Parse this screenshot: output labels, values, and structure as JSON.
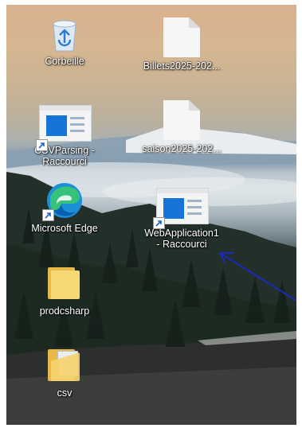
{
  "desktop": {
    "icons": [
      {
        "label": "Corbeille",
        "icon": "recycle-bin-icon"
      },
      {
        "label": "Billets2025-202...",
        "icon": "document-icon"
      },
      {
        "label": "CSVParsing -",
        "label2": "Raccourci",
        "icon": "app-shortcut-icon"
      },
      {
        "label": "saison2025-202...",
        "icon": "document-icon"
      },
      {
        "label": "Microsoft Edge",
        "icon": "edge-icon"
      },
      {
        "label": "WebApplication1",
        "label2": "- Raccourci",
        "icon": "app-shortcut-icon"
      },
      {
        "label": "prodcsharp",
        "icon": "folder-icon"
      },
      {
        "label": "csv",
        "icon": "folder-icon"
      }
    ]
  },
  "colors": {
    "annotation_arrow": "#1b2ab5",
    "accent_blue": "#1673d8",
    "folder": "#f8d775"
  }
}
